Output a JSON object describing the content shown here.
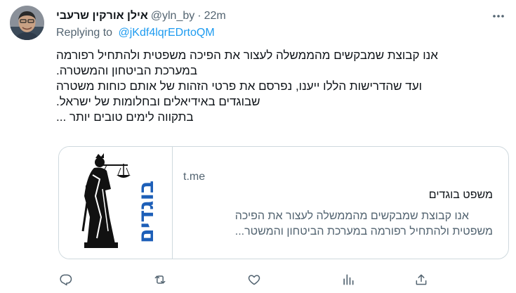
{
  "author": {
    "name": "אילן אורקין שרעבי",
    "handle": "@yln_by",
    "separator": "·",
    "time": "22m"
  },
  "replying": {
    "prefix": "Replying to",
    "to": "@jKdf4lqrEDrtoQM"
  },
  "tweet": {
    "lines": [
      "אנו קבוצת שמבקשים מהממשלה לעצור את הפיכה משפטית ולהתחיל רפורמה",
      "במערכת הביטחון והמשטרה.",
      "ועד שהדרישות הללו ייענו, נפרסם את פרטי הזהות של אותם כוחות משטרה",
      "שבוגדים באידיאלים ובחלומות של ישראל.",
      "בתקווה לימים טובים יותר ..."
    ]
  },
  "card": {
    "domain": "t.me",
    "title": "משפט בוגדים",
    "description_lines": [
      "אנו קבוצת שמבקשים מהממשלה לעצור את הפיכה",
      "משפטית ולהתחיל רפורמה במערכת הביטחון והמשטר..."
    ],
    "image_text": "בוגדים"
  },
  "actions": [
    {
      "icon": "reply-icon"
    },
    {
      "icon": "retweet-icon"
    },
    {
      "icon": "like-icon"
    },
    {
      "icon": "views-icon"
    },
    {
      "icon": "share-icon"
    }
  ],
  "colors": {
    "text": "#0f1419",
    "secondary": "#536471",
    "link": "#1d9bf0",
    "border": "#cfd9de",
    "logo_blue": "#1d5fb8"
  }
}
